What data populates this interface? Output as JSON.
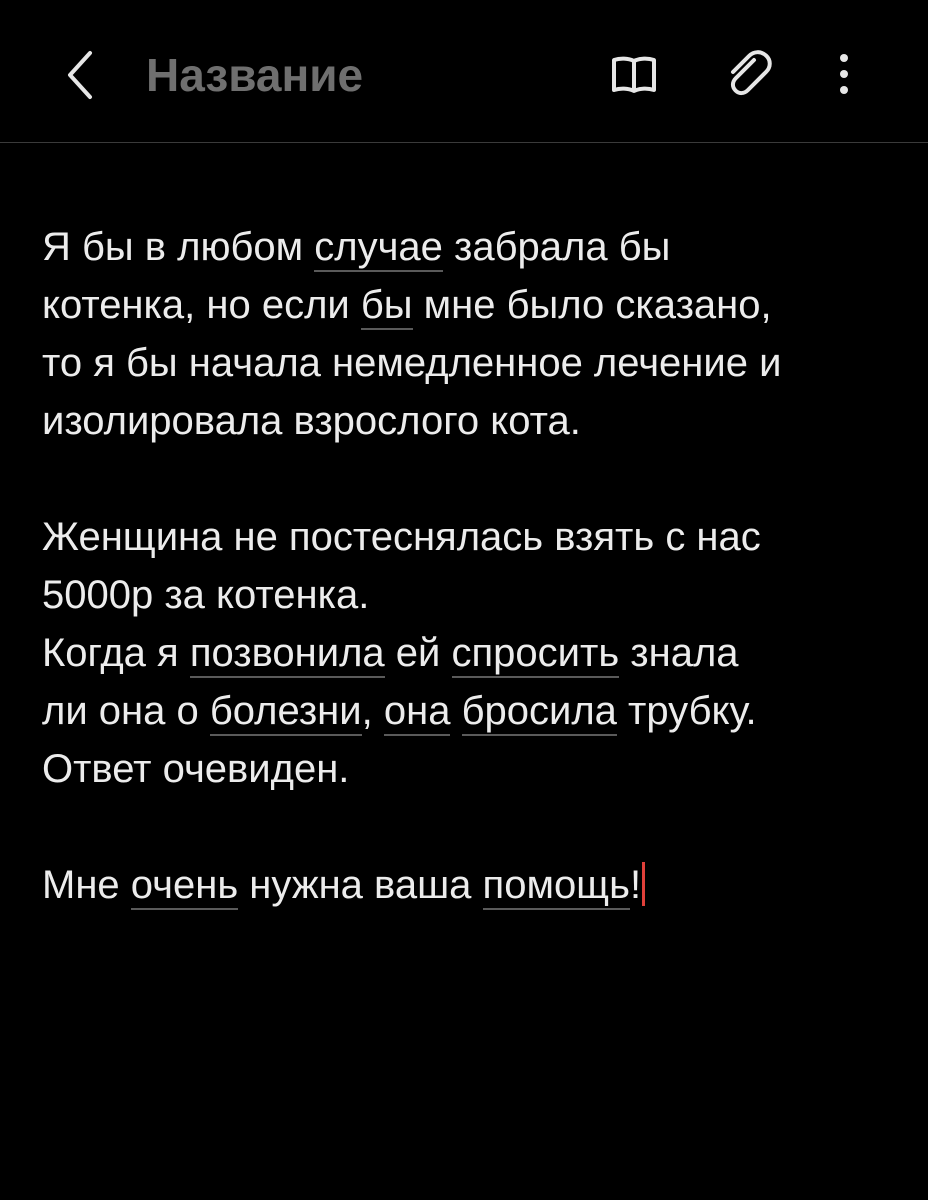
{
  "header": {
    "title": "Название",
    "icons": [
      "back-chevron-icon",
      "reading-mode-book-icon",
      "attach-paperclip-icon",
      "more-vertical-icon"
    ]
  },
  "note": {
    "para1": {
      "l1a": "Я бы в любом ",
      "l1b": "случае",
      "l1c": " забрала бы",
      "l2a": "котенка,  но если ",
      "l2b": "бы",
      "l2c": " мне было сказано,",
      "l3": "то я бы начала немедленное лечение и",
      "l4": "изолировала взрослого кота."
    },
    "para2": {
      "l1": "Женщина не постеснялась взять с нас",
      "l2": "5000р за котенка.",
      "l3a": "Когда я ",
      "l3b": "позвонила",
      "l3c": " ей ",
      "l3d": "спросить",
      "l3e": " знала",
      "l4a": "ли она о ",
      "l4b": "болезни",
      "l4c": ", ",
      "l4d": "она",
      "l4e": " ",
      "l4f": "бросила",
      "l4g": " трубку.",
      "l5": "Ответ очевиден."
    },
    "para3": {
      "l1a": "Мне ",
      "l1b": "очень",
      "l1c": " нужна ваша ",
      "l1d": "помощь",
      "l1e": "!"
    }
  },
  "colors": {
    "background": "#000000",
    "text": "#ececec",
    "title": "#6f6f6f",
    "caret": "#e0403a",
    "spell_underline": "#5a5a5a"
  }
}
